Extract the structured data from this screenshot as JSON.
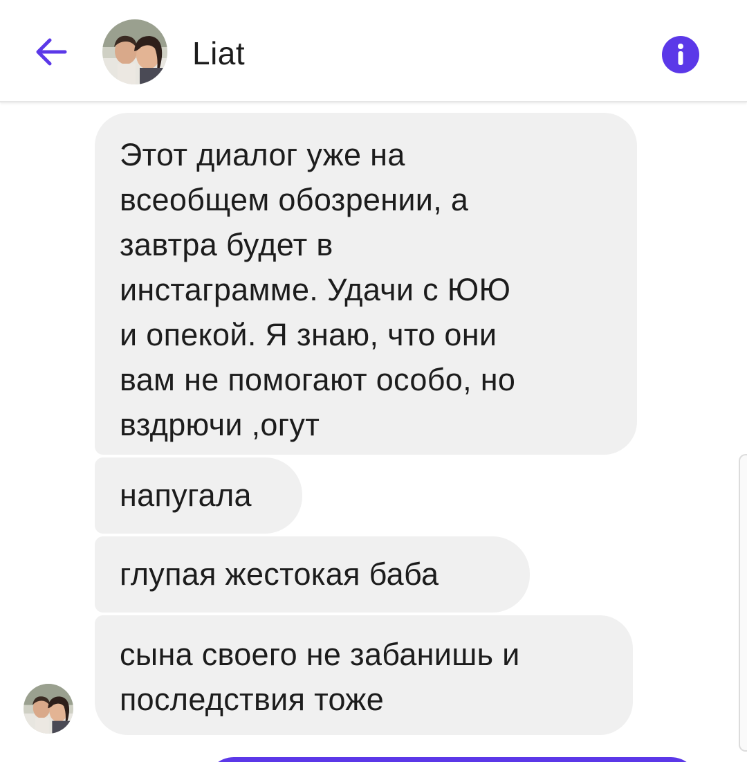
{
  "header": {
    "contact_name": "Liat",
    "back_icon": "arrow-left-icon",
    "info_icon": "info-icon",
    "accent_color": "#5b38e8"
  },
  "messages": [
    {
      "text": "Этот диалог уже на\nвсеобщем обозрении, а\nзавтра будет в\nинстаграмме. Удачи с ЮЮ\nи опекой. Я знаю, что они\nвам не помогают особо, но\nвздрючи ,огут"
    },
    {
      "text": "напугала"
    },
    {
      "text": "глупая жестокая баба"
    },
    {
      "text": "сына своего не забанишь и\nпоследствия тоже"
    }
  ],
  "colors": {
    "incoming_bubble": "#f0f0f0",
    "outgoing_bubble": "#5b38e8",
    "text": "#1c1c1c"
  }
}
